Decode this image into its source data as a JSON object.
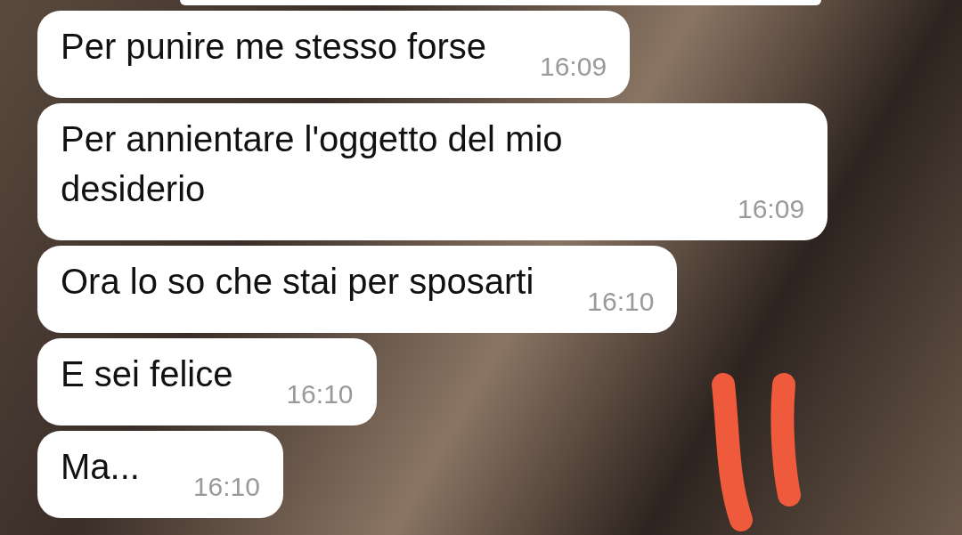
{
  "messages": [
    {
      "text": "Per punire me stesso forse",
      "time": "16:09"
    },
    {
      "text": "Per annientare l'oggetto del mio desiderio",
      "time": "16:09"
    },
    {
      "text": "Ora lo so che stai per sposarti",
      "time": "16:10"
    },
    {
      "text": "E sei felice",
      "time": "16:10"
    },
    {
      "text": "Ma...",
      "time": "16:10"
    }
  ]
}
